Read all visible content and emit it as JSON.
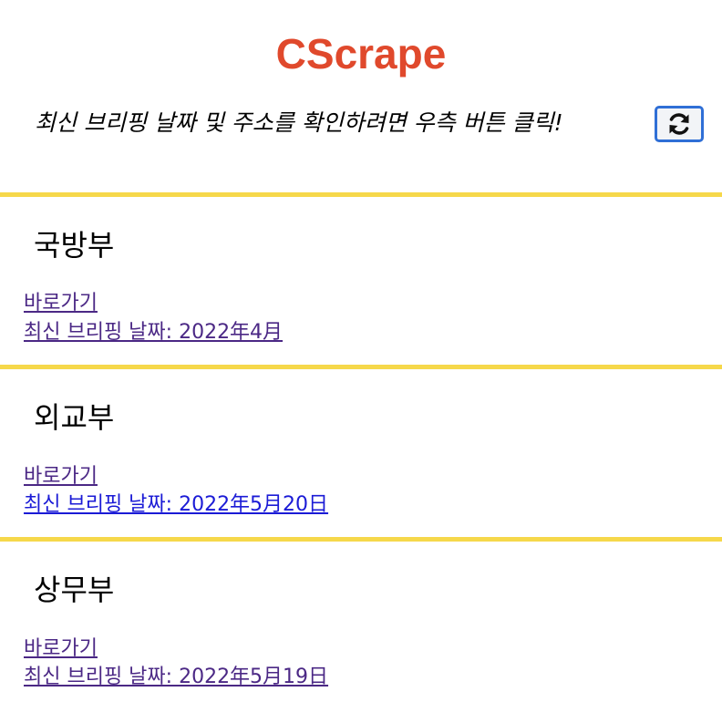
{
  "header": {
    "title": "CScrape",
    "instruction": "최신 브리핑 날짜 및 주소를 확인하려면 우측 버튼 클릭!",
    "refresh_icon": "refresh-icon"
  },
  "colors": {
    "title": "#e0492c",
    "divider": "#f6d84a",
    "button_border": "#2f6fd6",
    "visited_link": "#4b2885",
    "unvisited_link": "#1b1bd6"
  },
  "ministries": [
    {
      "name": "국방부",
      "link_label": "바로가기",
      "briefing_label": "최신 브리핑 날짜: 2022年4月"
    },
    {
      "name": "외교부",
      "link_label": "바로가기",
      "briefing_label": "최신 브리핑 날짜: 2022年5月20日"
    },
    {
      "name": "상무부",
      "link_label": "바로가기",
      "briefing_label": "최신 브리핑 날짜: 2022年5月19日"
    }
  ]
}
